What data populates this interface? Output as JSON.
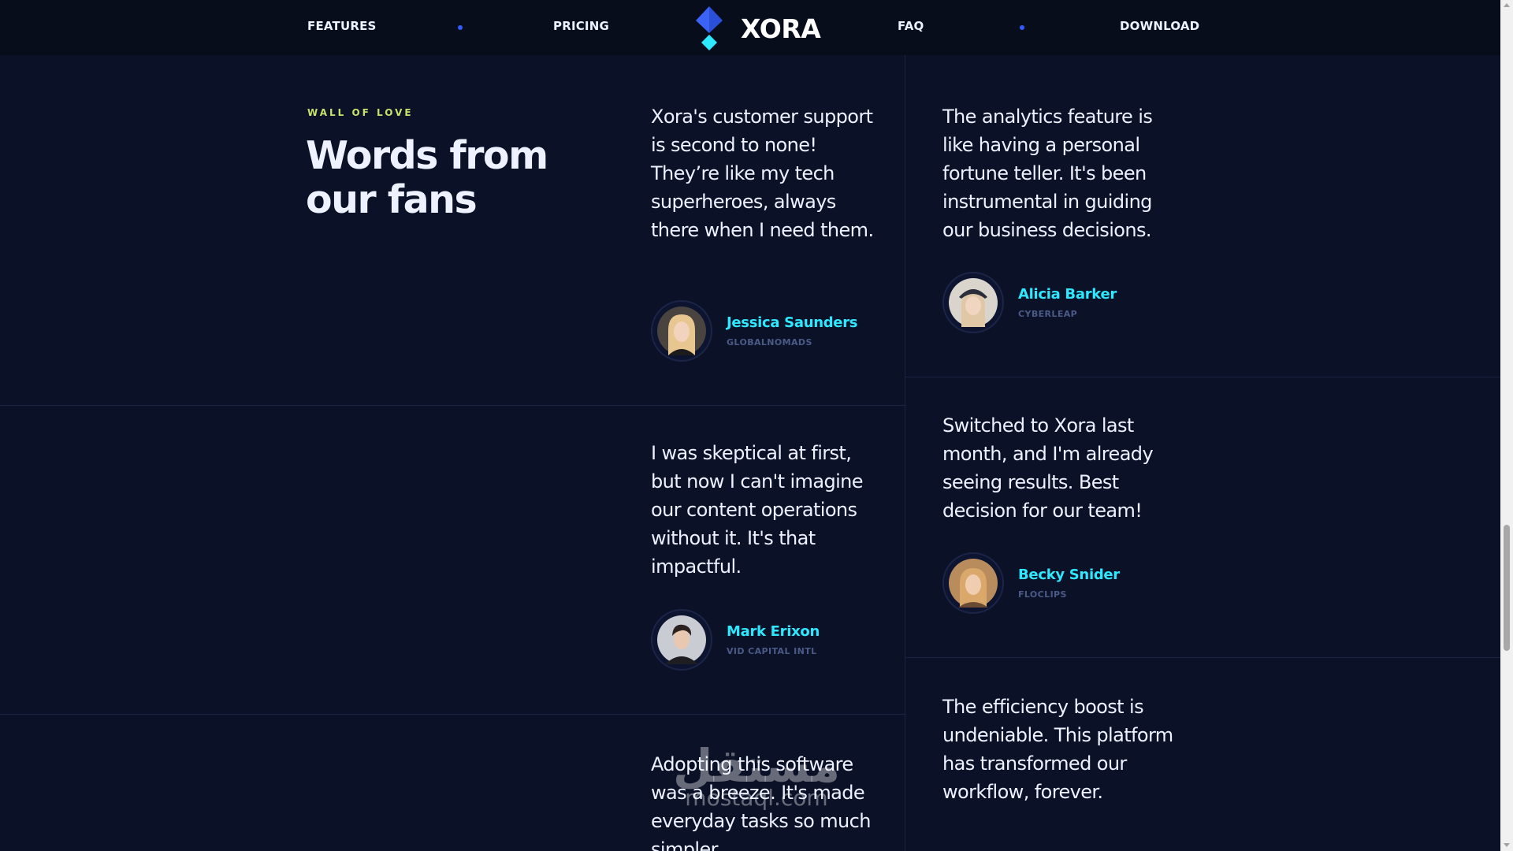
{
  "nav": {
    "links": {
      "features": "FEATURES",
      "pricing": "PRICING",
      "faq": "FAQ",
      "download": "DOWNLOAD"
    },
    "brand": "XORA",
    "dot_color": "#2f5bff"
  },
  "section": {
    "eyebrow": "WALL OF LOVE",
    "heading": "Words from our fans"
  },
  "testimonials": [
    {
      "quote": "Xora's customer support is second to none! They’re like my tech superheroes, always there when I need them.",
      "name": "Jessica Saunders",
      "company": "GLOBALNOMADS",
      "avatar_icon": "avatar-blonde-woman-icon"
    },
    {
      "quote": "The analytics feature is like having a personal fortune teller. It's been instrumental in guiding our business decisions.",
      "name": "Alicia Barker",
      "company": "CYBERLEAP",
      "avatar_icon": "avatar-woman-cap-icon"
    },
    {
      "quote": "I was skeptical at first, but now I can't imagine our content operations without it. It's that impactful.",
      "name": "Mark Erixon",
      "company": "VID CAPITAL INTL",
      "avatar_icon": "avatar-man-icon"
    },
    {
      "quote": "Switched to Xora last month, and I'm already seeing results. Best decision for our team!",
      "name": "Becky Snider",
      "company": "FLOCLIPS",
      "avatar_icon": "avatar-woman-sunset-icon"
    },
    {
      "quote": "Adopting this software was a breeze. It's made everyday tasks so much simpler.",
      "name": "",
      "company": "",
      "avatar_icon": ""
    },
    {
      "quote": "The efficiency boost is undeniable. This platform has transformed our workflow, forever.",
      "name": "",
      "company": "",
      "avatar_icon": ""
    }
  ],
  "watermark": {
    "arabic": "مستقل",
    "latin": "mostaql.com"
  },
  "colors": {
    "background": "#0b1127",
    "nav_background": "#080d1c",
    "heading": "#eef1ff",
    "eyebrow": "#c8e26b",
    "author_name": "#2ee8ff",
    "company": "#4b5a86",
    "divider": "#1a2340",
    "logo_primary": "#3b63f6",
    "logo_accent": "#2ee8ff"
  }
}
